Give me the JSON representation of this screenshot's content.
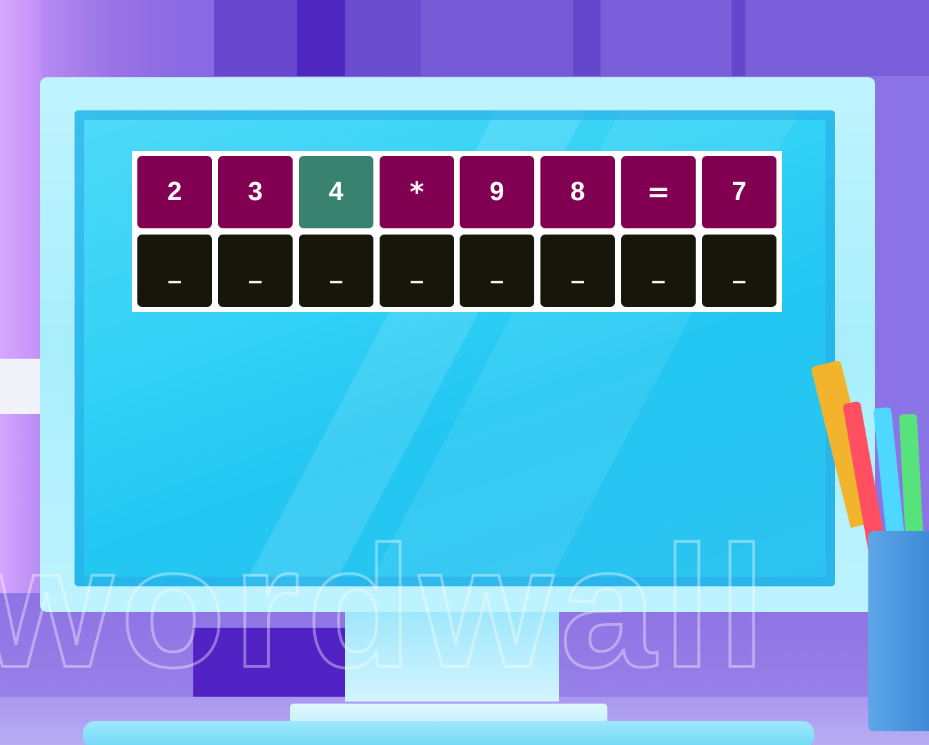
{
  "game": {
    "tiles": [
      {
        "label": "2",
        "color": "#820052"
      },
      {
        "label": "3",
        "color": "#820052"
      },
      {
        "label": "4",
        "color": "#3a8270",
        "highlighted": true
      },
      {
        "label": "*",
        "color": "#820052"
      },
      {
        "label": "9",
        "color": "#820052"
      },
      {
        "label": "8",
        "color": "#820052"
      },
      {
        "label": "=",
        "color": "#820052"
      },
      {
        "label": "7",
        "color": "#820052"
      }
    ],
    "slots": [
      "_",
      "_",
      "_",
      "_",
      "_",
      "_",
      "_",
      "_"
    ],
    "slot_color": "#17160a",
    "board_color": "#ffffff"
  },
  "background": {
    "watermark": "wordwall"
  },
  "colors": {
    "tile": "#820052",
    "tile_highlight": "#3a8270",
    "slot": "#17160a",
    "screen": "#34d2f6",
    "frame": "#bff4ff"
  }
}
